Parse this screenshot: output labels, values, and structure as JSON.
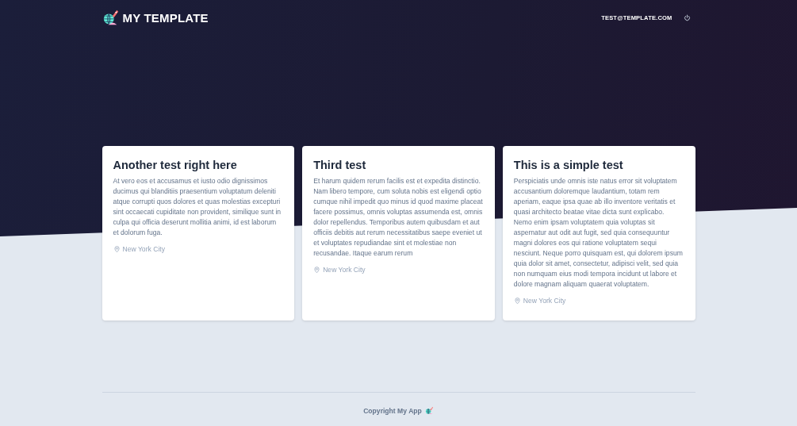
{
  "header": {
    "brand": "MY TEMPLATE",
    "user_email": "TEST@TEMPLATE.COM"
  },
  "cards": [
    {
      "title": "Another test right here",
      "body": "At vero eos et accusamus et iusto odio dignissimos ducimus qui blanditiis praesentium voluptatum deleniti atque corrupti quos dolores et quas molestias excepturi sint occaecati cupiditate non provident, similique sunt in culpa qui officia deserunt mollitia animi, id est laborum et dolorum fuga.",
      "location": "New York City"
    },
    {
      "title": "Third test",
      "body": "Et harum quidem rerum facilis est et expedita distinctio. Nam libero tempore, cum soluta nobis est eligendi optio cumque nihil impedit quo minus id quod maxime placeat facere possimus, omnis voluptas assumenda est, omnis dolor repellendus. Temporibus autem quibusdam et aut officiis debitis aut rerum necessitatibus saepe eveniet ut et voluptates repudiandae sint et molestiae non recusandae. Itaque earum rerum",
      "location": "New York City"
    },
    {
      "title": "This is a simple test",
      "body": "Perspiciatis unde omnis iste natus error sit voluptatem accusantium doloremque laudantium, totam rem aperiam, eaque ipsa quae ab illo inventore veritatis et quasi architecto beatae vitae dicta sunt explicabo. Nemo enim ipsam voluptatem quia voluptas sit aspernatur aut odit aut fugit, sed quia consequuntur magni dolores eos qui ratione voluptatem sequi nesciunt. Neque porro quisquam est, qui dolorem ipsum quia dolor sit amet, consectetur, adipisci velit, sed quia non numquam eius modi tempora incidunt ut labore et dolore magnam aliquam quaerat voluptatem.",
      "location": "New York City"
    }
  ],
  "footer": {
    "copyright": "Copyright My App"
  }
}
